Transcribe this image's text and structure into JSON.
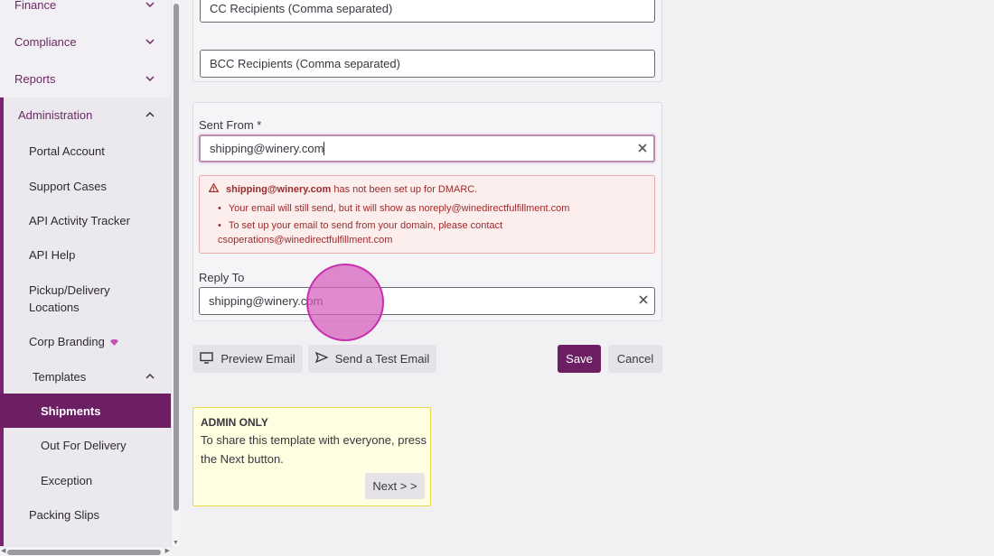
{
  "sidebar": {
    "items": [
      {
        "label": "Finance"
      },
      {
        "label": "Compliance"
      },
      {
        "label": "Reports"
      },
      {
        "label": "Administration"
      },
      {
        "label": "Portal Account"
      },
      {
        "label": "Support Cases"
      },
      {
        "label": "API Activity Tracker"
      },
      {
        "label": "API Help"
      },
      {
        "label": "Pickup/Delivery Locations"
      },
      {
        "label": "Corp Branding"
      },
      {
        "label": "Templates"
      },
      {
        "label": "Shipments"
      },
      {
        "label": "Out For Delivery"
      },
      {
        "label": "Exception"
      },
      {
        "label": "Packing Slips"
      }
    ],
    "accent_color": "#6d1f64"
  },
  "form": {
    "cc_placeholder": "CC Recipients (Comma separated)",
    "bcc_placeholder": "BCC Recipients (Comma separated)",
    "sent_from_label": "Sent From *",
    "sent_from_value": "shipping@winery.com",
    "reply_to_label": "Reply To",
    "reply_to_value": "shipping@winery.com"
  },
  "alert": {
    "email": "shipping@winery.com",
    "message": "has not been set up for DMARC.",
    "bullet1": "Your email will still send, but it will show as noreply@winedirectfulfillment.com",
    "bullet2_line1": "To set up your email to send from your domain, please contact",
    "bullet2_line2": "csoperations@winedirectfulfillment.com"
  },
  "actions": {
    "preview": "Preview Email",
    "test": "Send a Test Email",
    "save": "Save",
    "cancel": "Cancel"
  },
  "admin_box": {
    "title": "ADMIN ONLY",
    "body": "To share this template with everyone, press the Next button.",
    "next": "Next > >"
  }
}
